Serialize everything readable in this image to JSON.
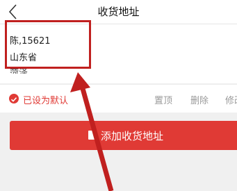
{
  "header": {
    "title": "收货地址",
    "back_icon": "chevron-left-icon"
  },
  "address": {
    "name_phone": "陈,15621",
    "province": "山东省",
    "city_partial": "菏泽"
  },
  "actions": {
    "default_label": "已设为默认",
    "set_top": "置顶",
    "delete": "删除",
    "edit": "修改"
  },
  "add_button": {
    "label": "添加收货地址",
    "icon": "book-icon"
  },
  "colors": {
    "accent": "#e03a35",
    "annotation": "#c0201f"
  }
}
